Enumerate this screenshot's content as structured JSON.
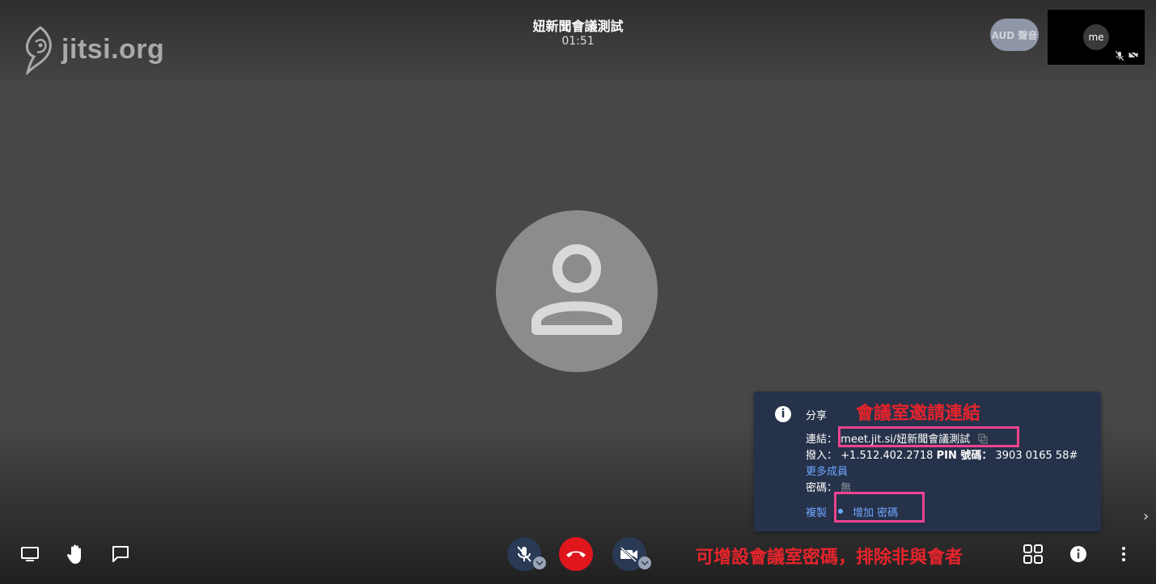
{
  "header": {
    "logo_text": "jitsi.org",
    "meeting_title": "妞新聞會議測試",
    "timer": "01:51"
  },
  "participants": {
    "aud_pill_label": "AUD 聲音",
    "self_label": "me"
  },
  "info_panel": {
    "heading": "分享",
    "link_label": "連結：",
    "link_value": "meet.jit.si/妞新聞會議測試",
    "dial_label": "撥入：",
    "dial_number": "+1.512.402.2718",
    "pin_label": "PIN 號碼：",
    "pin_value": "3903 0165 58#",
    "more_members": "更多成員",
    "password_label": "密碼：",
    "password_value": "無",
    "copy_label": "複製",
    "add_password_label": "增加 密碼"
  },
  "annotations": {
    "invite_link_note": "會議室邀請連結",
    "password_note": "可增設會議室密碼，排除非與會者"
  },
  "icons": {
    "screen_share": "screen-share-icon",
    "raise_hand": "raise-hand-icon",
    "chat": "chat-icon",
    "mic_off": "mic-off-icon",
    "hangup": "hangup-icon",
    "camera_off": "camera-off-icon",
    "tile_view": "tile-view-icon",
    "info": "info-icon",
    "more": "more-vertical-icon"
  },
  "colors": {
    "background": "#474747",
    "panel": "#26324a",
    "hangup": "#e0161d",
    "link": "#6fa5ff",
    "annotation": "#e8232b",
    "highlight": "#f0438f"
  }
}
